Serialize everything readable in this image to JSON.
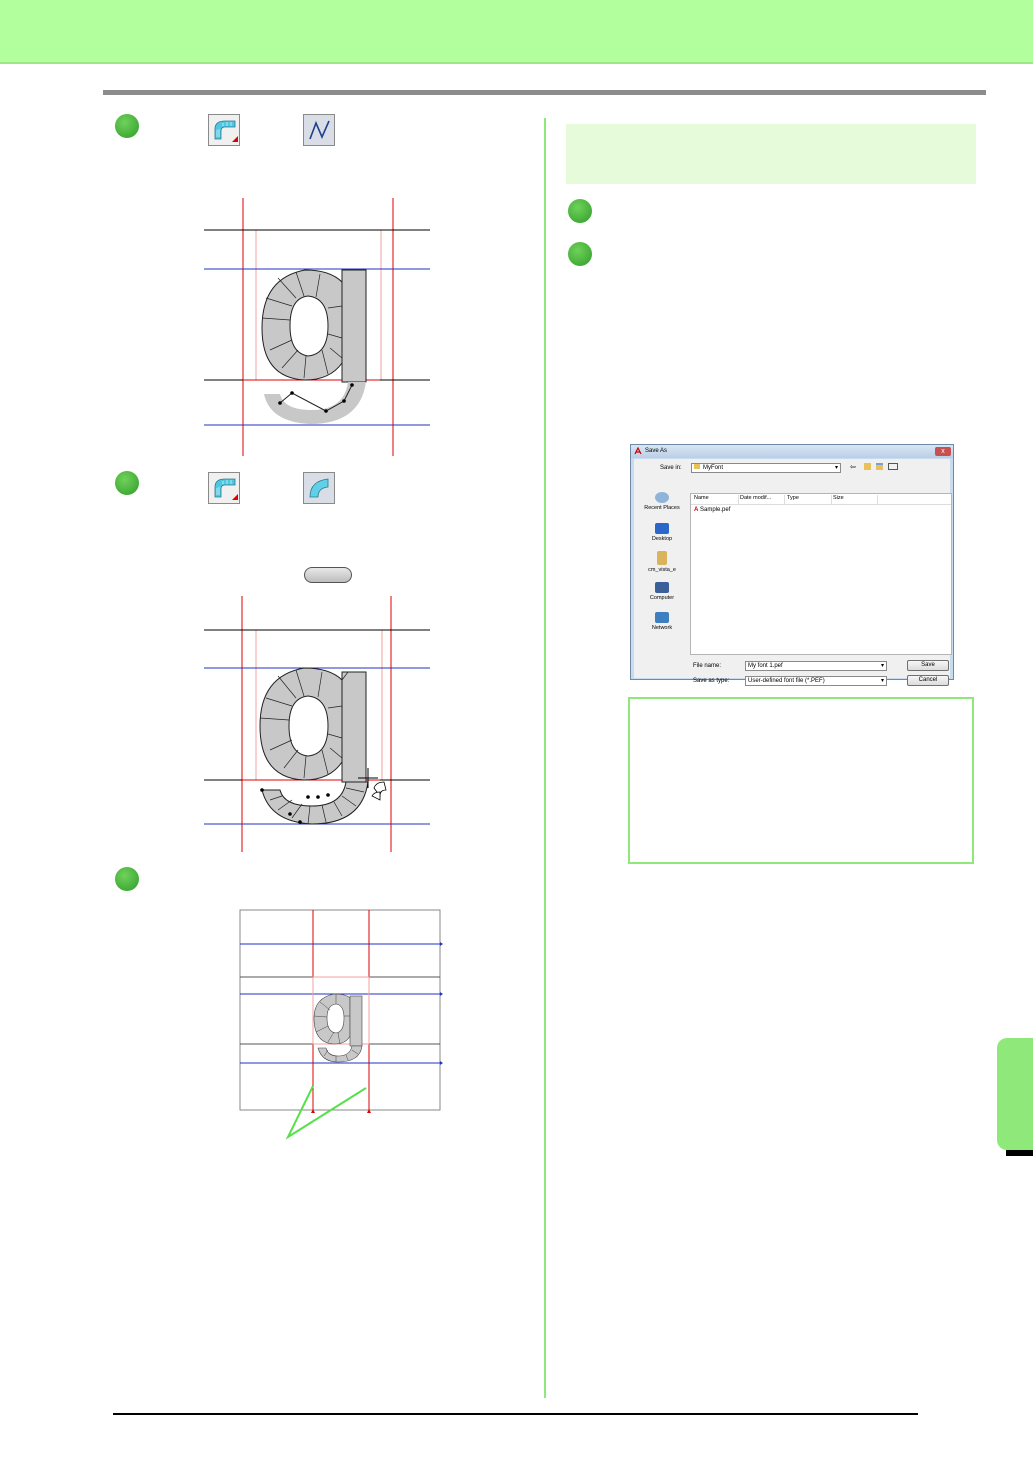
{
  "dialog": {
    "title": "Save As",
    "save_in_label": "Save in:",
    "save_in_value": "MyFont",
    "places": [
      "Recent Places",
      "Desktop",
      "cm_vista_e",
      "Computer",
      "Network"
    ],
    "columns": [
      "Name",
      "Date modif...",
      "Type",
      "Size"
    ],
    "files": [
      "Sample.pef"
    ],
    "file_name_label": "File name:",
    "file_name_value": "My font 1.pef",
    "save_as_type_label": "Save as type:",
    "save_as_type_value": "User-defined font file (*.PEF)",
    "save_button": "Save",
    "cancel_button": "Cancel",
    "close_glyph": "x"
  },
  "colors": {
    "header": "#b2ff9e",
    "accent_green": "#8fe87a",
    "guide_red": "#e00000",
    "guide_blue": "#2030c0",
    "glyph_fill": "#c8c8c8"
  },
  "icons": [
    "arc-tool-icon",
    "line-tool-icon",
    "arc-segment-icon"
  ]
}
